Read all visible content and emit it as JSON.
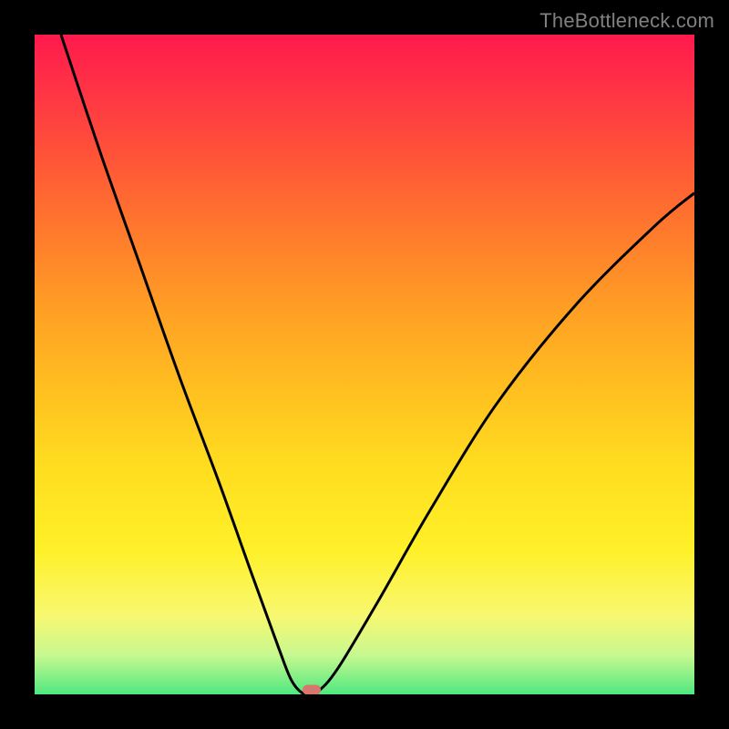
{
  "watermark": "TheBottleneck.com",
  "chart_data": {
    "type": "line",
    "title": "",
    "xlabel": "",
    "ylabel": "",
    "x_range": [
      0,
      100
    ],
    "y_range": [
      0,
      100
    ],
    "minimum_x_percent": 41,
    "series": [
      {
        "name": "bottleneck-curve",
        "points": [
          {
            "x": 4,
            "y": 100
          },
          {
            "x": 10,
            "y": 82
          },
          {
            "x": 16,
            "y": 65
          },
          {
            "x": 22,
            "y": 48
          },
          {
            "x": 28,
            "y": 32
          },
          {
            "x": 33,
            "y": 18
          },
          {
            "x": 37,
            "y": 7
          },
          {
            "x": 39,
            "y": 2
          },
          {
            "x": 41,
            "y": 0
          },
          {
            "x": 43,
            "y": 0.5
          },
          {
            "x": 46,
            "y": 4
          },
          {
            "x": 52,
            "y": 14
          },
          {
            "x": 60,
            "y": 28
          },
          {
            "x": 70,
            "y": 44
          },
          {
            "x": 82,
            "y": 59
          },
          {
            "x": 94,
            "y": 71
          },
          {
            "x": 100,
            "y": 76
          }
        ]
      }
    ],
    "marker": {
      "x_percent": 42,
      "y_percent": 99.3
    },
    "background_gradient": {
      "top": "#ff1a4c",
      "bottom": "#50e880"
    }
  }
}
